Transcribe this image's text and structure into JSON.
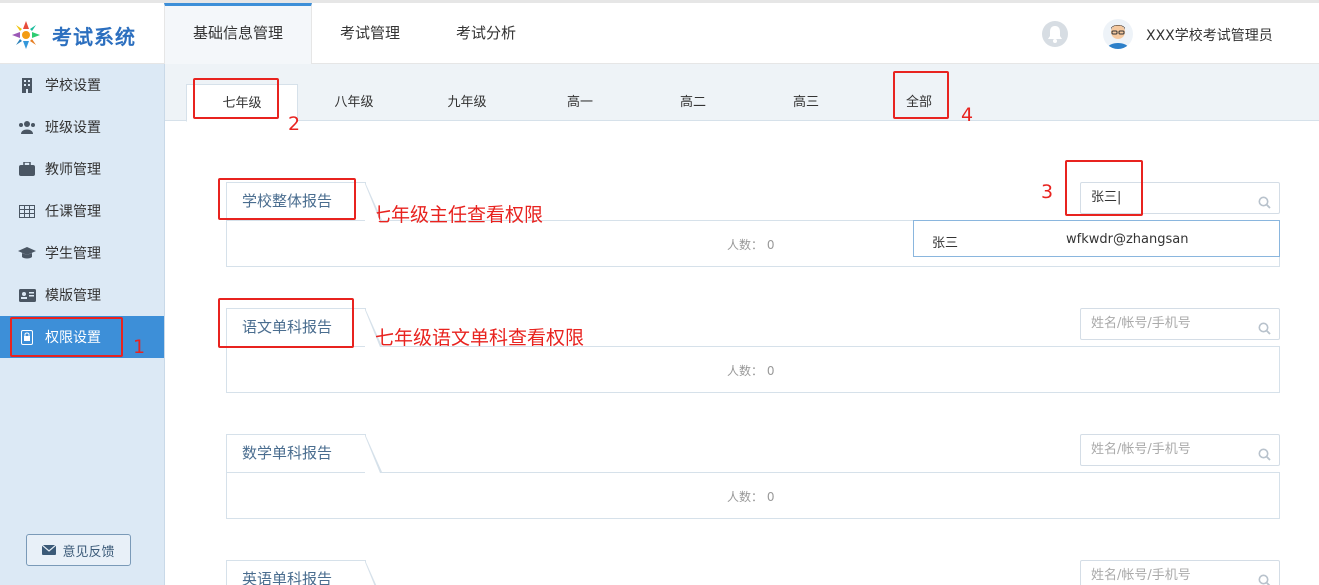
{
  "app": {
    "title": "考试系统"
  },
  "topnav": [
    {
      "label": "基础信息管理",
      "active": true
    },
    {
      "label": "考试管理",
      "active": false
    },
    {
      "label": "考试分析",
      "active": false
    }
  ],
  "user": {
    "name": "XXX学校考试管理员"
  },
  "sidebar": {
    "items": [
      {
        "label": "学校设置",
        "icon": "building-icon"
      },
      {
        "label": "班级设置",
        "icon": "users-icon"
      },
      {
        "label": "教师管理",
        "icon": "briefcase-icon"
      },
      {
        "label": "任课管理",
        "icon": "table-icon"
      },
      {
        "label": "学生管理",
        "icon": "graduation-cap-icon"
      },
      {
        "label": "模版管理",
        "icon": "id-card-icon"
      },
      {
        "label": "权限设置",
        "icon": "lock-icon",
        "active": true
      }
    ],
    "feedback": "意见反馈"
  },
  "grade_tabs": [
    {
      "label": "七年级",
      "active": true
    },
    {
      "label": "八年级"
    },
    {
      "label": "九年级"
    },
    {
      "label": "高一"
    },
    {
      "label": "高二"
    },
    {
      "label": "高三"
    },
    {
      "label": "全部"
    }
  ],
  "sections": [
    {
      "title": "学校整体报告",
      "count_label": "人数：",
      "count": "0",
      "search_value": "张三",
      "search_placeholder": "姓名/帐号/手机号"
    },
    {
      "title": "语文单科报告",
      "count_label": "人数：",
      "count": "0",
      "search_value": "",
      "search_placeholder": "姓名/帐号/手机号"
    },
    {
      "title": "数学单科报告",
      "count_label": "人数：",
      "count": "0",
      "search_value": "",
      "search_placeholder": "姓名/帐号/手机号"
    },
    {
      "title": "英语单科报告",
      "count_label": "人数：",
      "count": "",
      "search_value": "",
      "search_placeholder": "姓名/帐号/手机号"
    }
  ],
  "dropdown": {
    "name": "张三",
    "account": "wfkwdr@zhangsan"
  },
  "annotations": {
    "n1": "1",
    "n2": "2",
    "n3": "3",
    "n4": "4",
    "note1": "七年级主任查看权限",
    "note2": "七年级语文单科查看权限"
  },
  "colors": {
    "accent": "#3d8fd8",
    "sidebar_bg": "#dce9f5",
    "annotation": "#e8231f"
  }
}
